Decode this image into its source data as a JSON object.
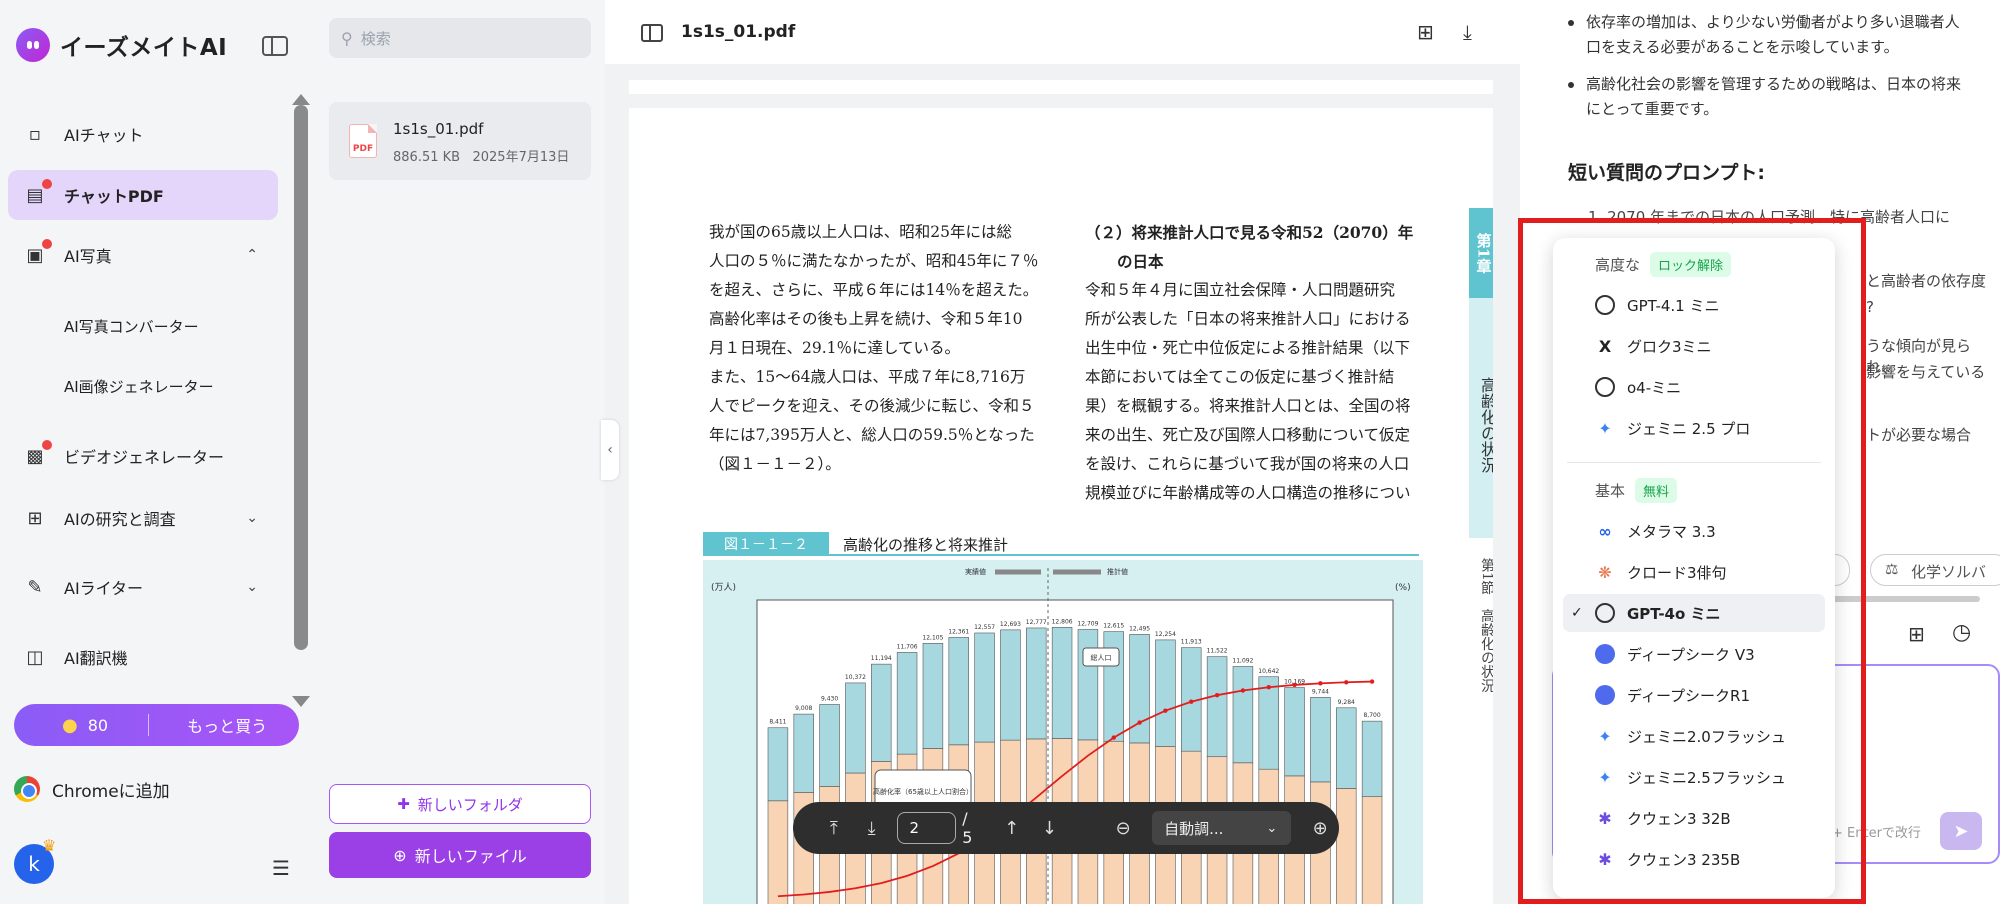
{
  "app": {
    "name": "イーズメイトAI"
  },
  "sidebar": {
    "items": [
      {
        "label": "AIチャット",
        "icon": "chat-icon"
      },
      {
        "label": "チャットPDF",
        "icon": "pdf-chat-icon",
        "active": true
      },
      {
        "label": "AI写真",
        "icon": "photo-icon"
      },
      {
        "label": "AI写真コンバーター"
      },
      {
        "label": "AI画像ジェネレーター"
      },
      {
        "label": "ビデオジェネレーター",
        "icon": "video-icon"
      },
      {
        "label": "AIの研究と調査",
        "icon": "research-icon"
      },
      {
        "label": "AIライター",
        "icon": "writer-icon"
      },
      {
        "label": "AI翻訳機",
        "icon": "translate-icon"
      }
    ],
    "credits": {
      "count": "80",
      "buy_label": "もっと買う"
    },
    "chrome_label": "Chromeに追加",
    "avatar_letter": "k"
  },
  "files": {
    "search_placeholder": "検索",
    "items": [
      {
        "name": "1s1s_01.pdf",
        "size": "886.51 KB",
        "date": "2025年7月13日"
      }
    ],
    "new_folder_label": "新しいフォルダ",
    "new_file_label": "新しいファイル"
  },
  "viewer": {
    "title": "1s1s_01.pdf",
    "page_current": "2",
    "page_total": "/ 5",
    "zoom_label": "自動調...",
    "pdf": {
      "col1": [
        "我が国の65歳以上人口は、昭和25年には総",
        "人口の５％に満たなかったが、昭和45年に７％",
        "を超え、さらに、平成６年には14％を超えた。",
        "高齢化率はその後も上昇を続け、令和５年10",
        "月１日現在、29.1％に達している。",
        "また、15～64歳人口は、平成７年に8,716万",
        "人でピークを迎え、その後減少に転じ、令和５",
        "年には7,395万人と、総人口の59.5％となった",
        "（図１－１－２）。"
      ],
      "col2_heading_1": "（２）将来推計人口で見る令和52（2070）年",
      "col2_heading_2": "の日本",
      "col2": [
        "令和５年４月に国立社会保障・人口問題研究",
        "所が公表した「日本の将来推計人口」における",
        "出生中位・死亡中位仮定による推計結果（以下",
        "本節においては全てこの仮定に基づく推計結",
        "果）を概観する。将来推計人口とは、全国の将",
        "来の出生、死亡及び国際人口移動について仮定",
        "を設け、これらに基づいて我が国の将来の人口",
        "規模並びに年齢構成等の人口構造の推移につい"
      ],
      "chapter_tab": "第1章",
      "chapter_side": "高齢化の状況",
      "section_side": "第1節　高齢化の状況",
      "figure_number": "図１－１－２",
      "figure_title": "高齢化の推移と将来推計"
    }
  },
  "chat": {
    "bullets": [
      "依存率の増加は、より少ない労働者がより多い退職者人口を支える必要があることを示唆しています。",
      "高齢化社会の影響を管理するための戦略は、日本の将来にとって重要です。"
    ],
    "short_questions_title": "短い質問のプロンプト:",
    "partial_lines": [
      "1. 2070 年までの日本の人口予測、特に高齢者人口に",
      "と高齢者の依存度",
      "?",
      "うな傾向が見られ、",
      "影響を与えている",
      "トが必要な場合"
    ],
    "chemistry_chip": "化学ソルバ",
    "enter_hint": "+ Enterで改行"
  },
  "model_dropdown": {
    "advanced_label": "高度な",
    "advanced_tag": "ロック解除",
    "advanced": [
      {
        "label": "GPT-4.1 ミニ",
        "icon": "openai-icon"
      },
      {
        "label": "グロク3ミニ",
        "icon": "grok-icon"
      },
      {
        "label": "o4-ミニ",
        "icon": "openai-icon"
      },
      {
        "label": "ジェミニ 2.5 プロ",
        "icon": "gemini-icon"
      }
    ],
    "basic_label": "基本",
    "basic_tag": "無料",
    "basic": [
      {
        "label": "メタラマ 3.3",
        "icon": "meta-icon"
      },
      {
        "label": "クロード3俳句",
        "icon": "claude-icon"
      },
      {
        "label": "GPT-4o ミニ",
        "icon": "openai-icon",
        "selected": true
      },
      {
        "label": "ディープシーク V3",
        "icon": "deepseek-icon"
      },
      {
        "label": "ディープシークR1",
        "icon": "deepseek-icon"
      },
      {
        "label": "ジェミニ2.0フラッシュ",
        "icon": "gemini-icon"
      },
      {
        "label": "ジェミニ2.5フラッシュ",
        "icon": "gemini-icon"
      },
      {
        "label": "クウェン3 32B",
        "icon": "qwen-icon"
      },
      {
        "label": "クウェン3 235B",
        "icon": "qwen-icon"
      }
    ]
  },
  "chart_data": {
    "type": "bar",
    "title": "高齢化の推移と将来推計",
    "y_left_unit": "(万人)",
    "y_right_unit": "(%)",
    "bar_totals": [
      8411,
      9008,
      9430,
      10372,
      11194,
      11706,
      12105,
      12361,
      12557,
      12693,
      12777,
      12806,
      12709,
      12615,
      12495,
      12254,
      11913,
      11522,
      11092,
      10642,
      10169,
      9744,
      9284,
      8700
    ],
    "aged_line_points": 24,
    "legend": [
      "総人口"
    ],
    "annotations": [
      "高齢化率（65歳以上人口割合）",
      "実績値",
      "推計値"
    ]
  }
}
